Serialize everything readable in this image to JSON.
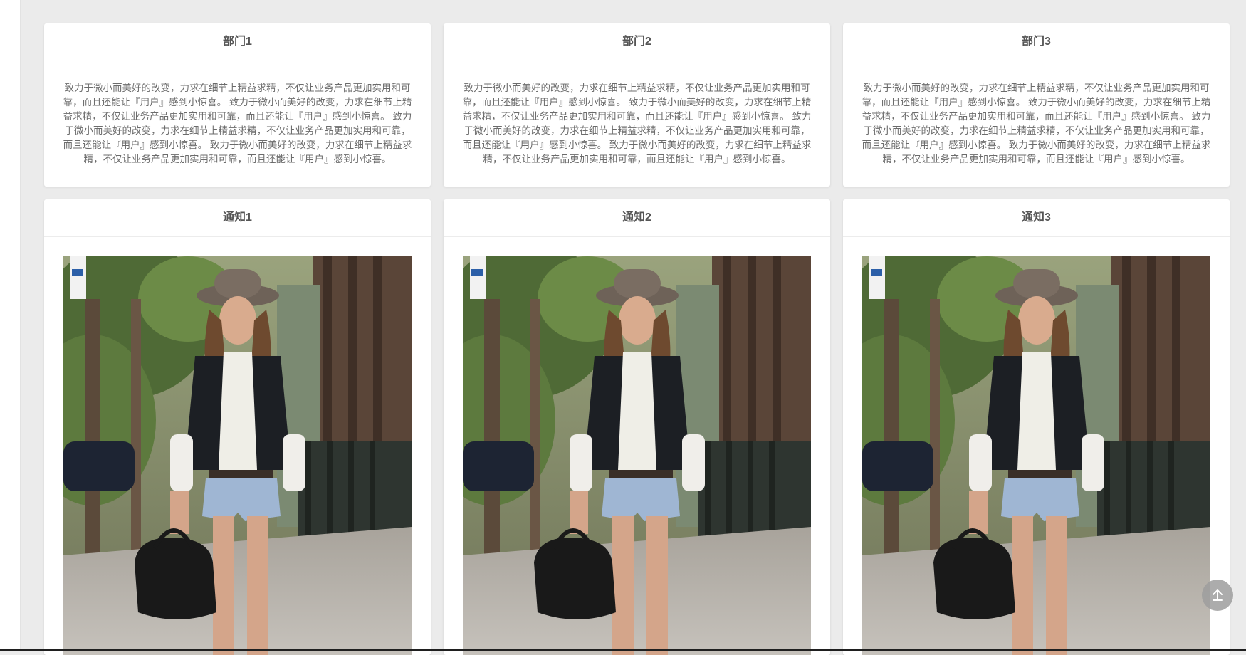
{
  "departments": [
    {
      "title": "部门1",
      "text": "致力于微小而美好的改变，力求在细节上精益求精，不仅让业务产品更加实用和可靠，而且还能让『用户』感到小惊喜。 致力于微小而美好的改变，力求在细节上精益求精，不仅让业务产品更加实用和可靠，而且还能让『用户』感到小惊喜。 致力于微小而美好的改变，力求在细节上精益求精，不仅让业务产品更加实用和可靠，而且还能让『用户』感到小惊喜。 致力于微小而美好的改变，力求在细节上精益求精，不仅让业务产品更加实用和可靠，而且还能让『用户』感到小惊喜。"
    },
    {
      "title": "部门2",
      "text": "致力于微小而美好的改变，力求在细节上精益求精，不仅让业务产品更加实用和可靠，而且还能让『用户』感到小惊喜。 致力于微小而美好的改变，力求在细节上精益求精，不仅让业务产品更加实用和可靠，而且还能让『用户』感到小惊喜。 致力于微小而美好的改变，力求在细节上精益求精，不仅让业务产品更加实用和可靠，而且还能让『用户』感到小惊喜。 致力于微小而美好的改变，力求在细节上精益求精，不仅让业务产品更加实用和可靠，而且还能让『用户』感到小惊喜。"
    },
    {
      "title": "部门3",
      "text": "致力于微小而美好的改变，力求在细节上精益求精，不仅让业务产品更加实用和可靠，而且还能让『用户』感到小惊喜。 致力于微小而美好的改变，力求在细节上精益求精，不仅让业务产品更加实用和可靠，而且还能让『用户』感到小惊喜。 致力于微小而美好的改变，力求在细节上精益求精，不仅让业务产品更加实用和可靠，而且还能让『用户』感到小惊喜。 致力于微小而美好的改变，力求在细节上精益求精，不仅让业务产品更加实用和可靠，而且还能让『用户』感到小惊喜。"
    }
  ],
  "notices": [
    {
      "title": "通知1"
    },
    {
      "title": "通知2"
    },
    {
      "title": "通知3"
    }
  ],
  "back_to_top_icon": "arrow-up-icon"
}
